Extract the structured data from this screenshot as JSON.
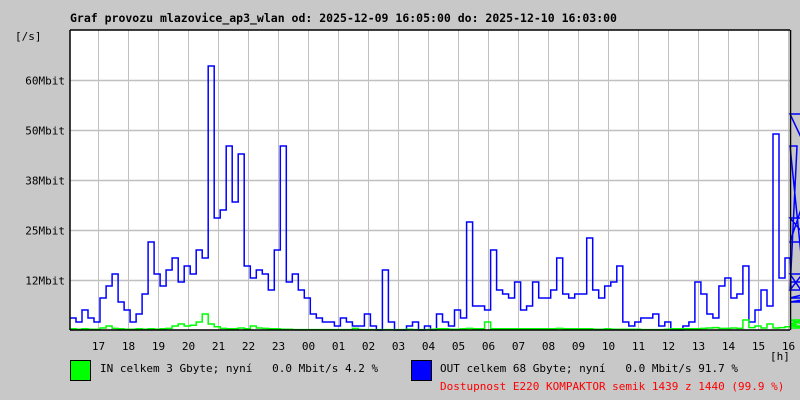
{
  "title": "Graf provozu mlazovice_ap3_wlan od: 2025-12-09 16:05:00 do: 2025-12-10 16:03:00",
  "legend": {
    "in_text": "IN celkem 3 Gbyte; nyní   0.0 Mbit/s 4.2 %",
    "out_text": "OUT celkem 68 Gbyte; nyní   0.0 Mbit/s 91.7 %",
    "availability": "Dostupnost E220 KOMPAKTOR semik 1439 z 1440 (99.9 %)"
  },
  "chart_data": {
    "type": "line",
    "title": "Graf provozu mlazovice_ap3_wlan od: 2025-12-09 16:05:00 do: 2025-12-10 16:03:00",
    "ylabel": "[/s]",
    "xlabel": "[h]",
    "ylim": [
      0,
      75
    ],
    "y_ticks": [
      {
        "value": 12.5,
        "label": "12Mbit"
      },
      {
        "value": 25,
        "label": "25Mbit"
      },
      {
        "value": 37.5,
        "label": "38Mbit"
      },
      {
        "value": 50,
        "label": "50Mbit"
      },
      {
        "value": 62.5,
        "label": "60Mbit"
      }
    ],
    "x_range_minutes": [
      0,
      1438
    ],
    "x_start": "16:05",
    "x_ticks": [
      "17",
      "18",
      "19",
      "20",
      "21",
      "22",
      "23",
      "00",
      "01",
      "02",
      "03",
      "04",
      "05",
      "06",
      "07",
      "08",
      "09",
      "10",
      "11",
      "12",
      "13",
      "14",
      "15",
      "16"
    ],
    "sample_interval_min": 12,
    "grid": true,
    "series": [
      {
        "name": "IN",
        "color": "#00ff00",
        "unit": "Mbit/s",
        "values": [
          0.3,
          0.2,
          0.3,
          0.2,
          0.2,
          0.5,
          1,
          0.4,
          0.3,
          0.2,
          0.2,
          0.3,
          0.2,
          0.3,
          0.2,
          0.3,
          0.4,
          1,
          1.5,
          1,
          1.2,
          2,
          4,
          1.5,
          0.8,
          0.4,
          0.3,
          0.3,
          0.5,
          0.3,
          1,
          0.5,
          0.4,
          0.3,
          0.3,
          0.2,
          0.2,
          0.1,
          0.1,
          0.1,
          0.1,
          0.1,
          0.1,
          0.1,
          0.1,
          0.1,
          0.1,
          0.4,
          0.1,
          0.1,
          0.1,
          0.1,
          0.1,
          0.1,
          0.1,
          0.1,
          0.2,
          0.1,
          0.1,
          0.1,
          0.2,
          0.3,
          0.3,
          0.2,
          0.2,
          0.3,
          0.4,
          0.3,
          0.3,
          2,
          0.3,
          0.3,
          0.3,
          0.3,
          0.3,
          0.3,
          0.3,
          0.3,
          0.3,
          0.3,
          0.3,
          0.4,
          0.3,
          0.3,
          0.3,
          0.3,
          0.3,
          0.2,
          0.2,
          0.3,
          0.2,
          0.2,
          0.2,
          0.2,
          0.2,
          0.1,
          0.1,
          0.1,
          0.1,
          0.2,
          0.3,
          0.3,
          0.3,
          0.3,
          0.3,
          0.4,
          0.5,
          0.6,
          0.4,
          0.4,
          0.5,
          0.4,
          2.5,
          0.6,
          1,
          0.5,
          1.5,
          0.5,
          0.6,
          0.8,
          1,
          1.5,
          2.5,
          1,
          0.5
        ]
      },
      {
        "name": "OUT",
        "color": "#0000ff",
        "unit": "Mbit/s",
        "values": [
          3,
          2,
          5,
          3,
          2,
          8,
          11,
          14,
          7,
          5,
          2,
          4,
          9,
          22,
          14,
          11,
          15,
          18,
          12,
          16,
          14,
          20,
          18,
          66,
          28,
          30,
          46,
          32,
          44,
          16,
          13,
          15,
          14,
          10,
          20,
          46,
          12,
          14,
          10,
          8,
          4,
          3,
          2,
          2,
          1,
          3,
          2,
          1,
          1,
          4,
          1,
          0,
          15,
          2,
          0,
          0,
          1,
          2,
          0,
          1,
          0,
          4,
          2,
          1,
          5,
          3,
          27,
          6,
          6,
          5,
          20,
          10,
          9,
          8,
          12,
          5,
          6,
          12,
          8,
          8,
          10,
          18,
          9,
          8,
          9,
          9,
          23,
          10,
          8,
          11,
          12,
          16,
          2,
          1,
          2,
          3,
          3,
          4,
          1,
          2,
          0,
          0,
          1,
          2,
          12,
          9,
          4,
          3,
          11,
          13,
          8,
          9,
          16,
          2,
          5,
          10,
          6,
          49,
          13,
          18,
          10,
          46,
          14,
          7,
          8,
          10,
          22,
          54,
          28,
          12
        ]
      }
    ]
  }
}
